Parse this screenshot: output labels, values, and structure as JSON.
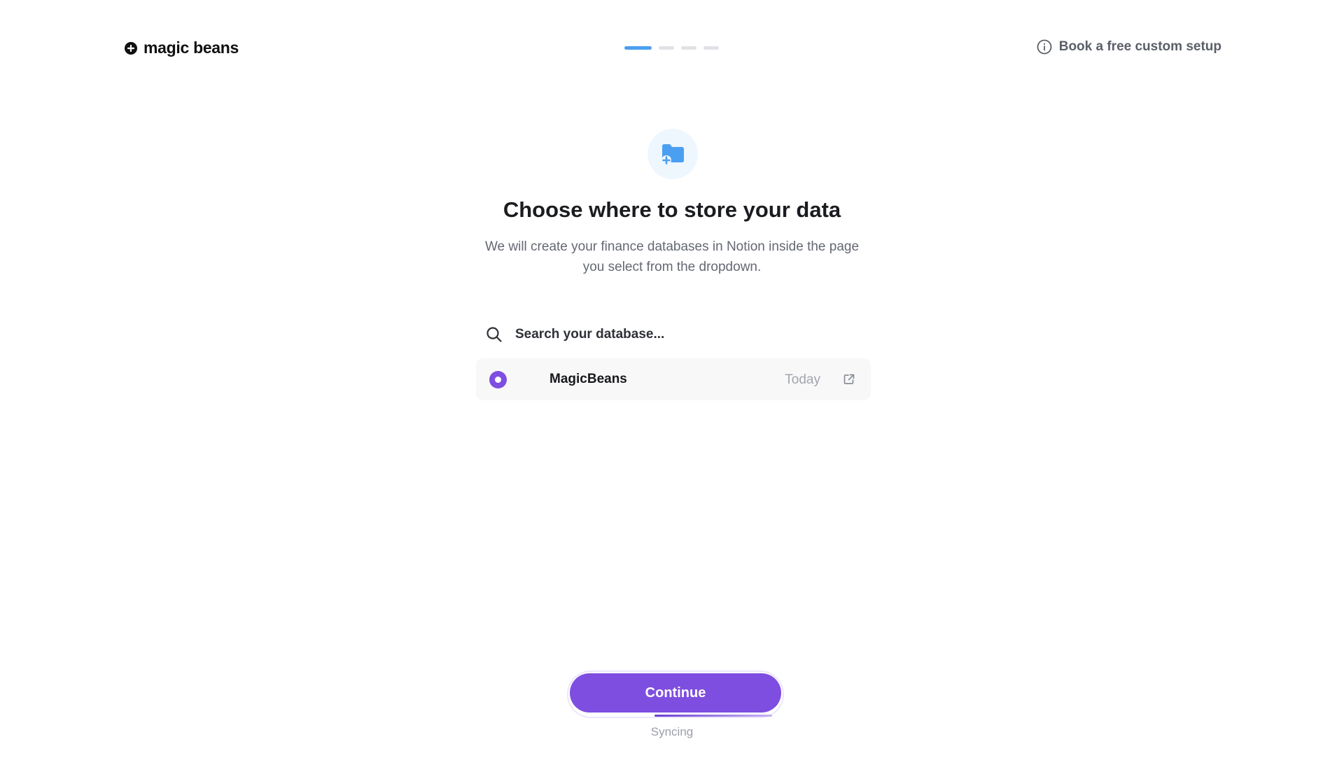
{
  "header": {
    "logo_text": "magic beans",
    "steps": {
      "total": 4,
      "current": 1
    },
    "help_link": "Book a free custom setup"
  },
  "hero": {
    "icon": "folder-plus-icon",
    "title": "Choose where to store your data",
    "subtitle": "We will create your finance databases in Notion inside the page you select from the dropdown."
  },
  "search": {
    "placeholder": "Search your database...",
    "value": ""
  },
  "databases": [
    {
      "name": "MagicBeans",
      "date": "Today",
      "selected": true
    }
  ],
  "footer": {
    "continue_label": "Continue",
    "status": "Syncing"
  },
  "colors": {
    "accent": "#7e4ee0",
    "step_active": "#4b9ff1",
    "icon_bg": "#eef6fe",
    "icon_fg": "#4b9ff1"
  }
}
